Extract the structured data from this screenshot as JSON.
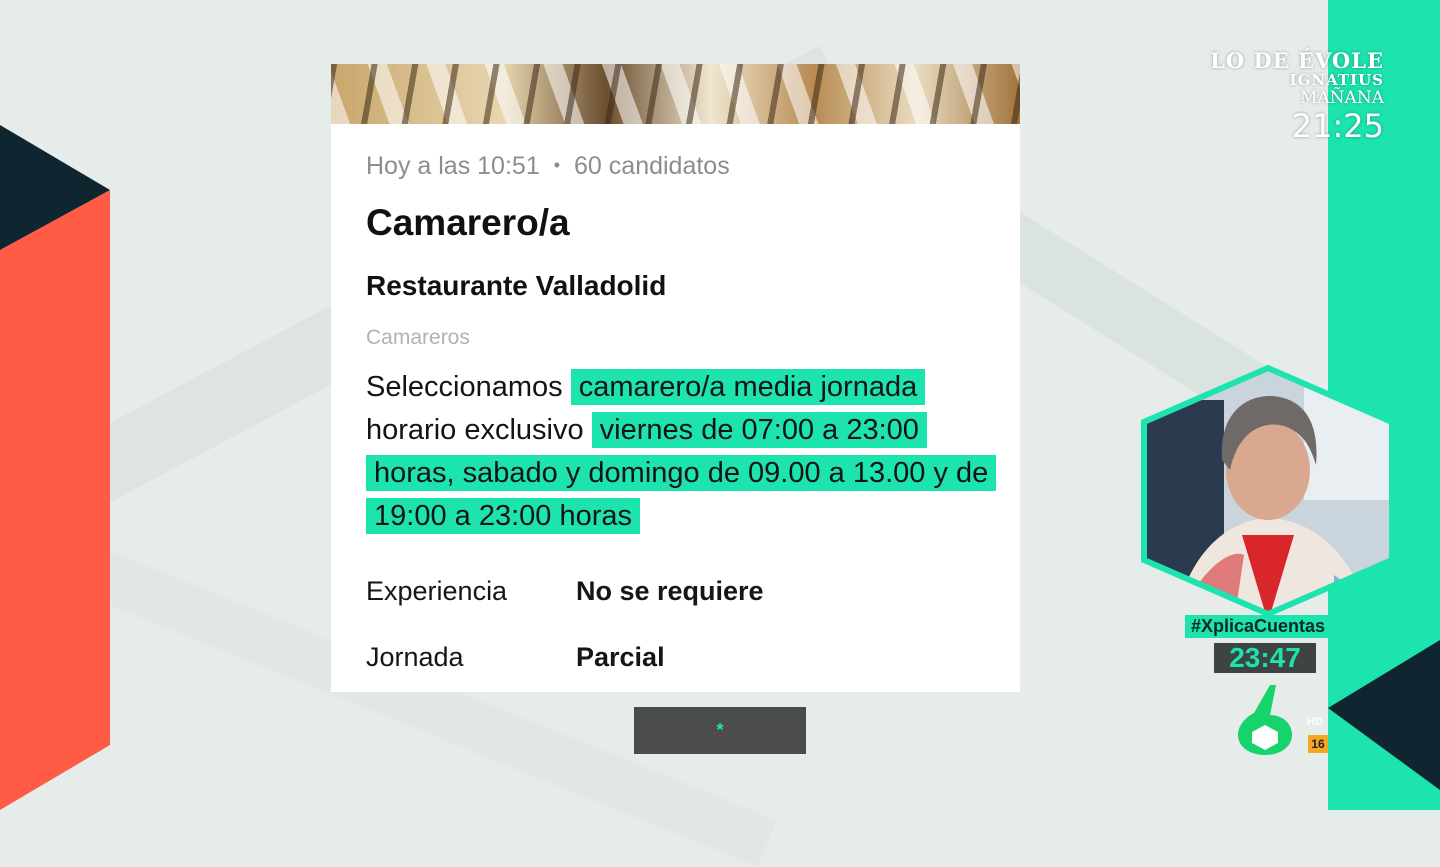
{
  "job_card": {
    "meta_time": "Hoy a las 10:51",
    "meta_separator": "•",
    "meta_candidates": "60 candidatos",
    "title": "Camarero/a",
    "company": "Restaurante Valladolid",
    "category": "Camareros",
    "description": {
      "part1": "Seleccionamos ",
      "highlight1": "camarero/a media jornada",
      "part2": " horario exclusivo ",
      "highlight2": "viernes de 07:00 a 23:00 horas, sabado y domingo de 09.00 a 13.00 y de 19:00 a 23:00 horas"
    },
    "details": [
      {
        "label": "Experiencia",
        "value": "No se requiere"
      },
      {
        "label": "Jornada",
        "value": "Parcial"
      }
    ]
  },
  "bottom_bar": {
    "label": "*"
  },
  "tv_overlay": {
    "promo_show": "LO DE ÉVOLE",
    "promo_guest": "IGNATIUS",
    "promo_day": "MAÑANA",
    "promo_time": "21:25",
    "hashtag": "#XplicaCuentas",
    "clock": "23:47",
    "channel_logo": "laSexta 6 logo",
    "hd_label": "HD",
    "age_rating": "16"
  },
  "colors": {
    "accent_teal": "#1de3ae",
    "coral": "#ff5b45",
    "dark_navy": "#0f2630",
    "card_bg": "#ffffff",
    "bar_grey": "#4b4d4c"
  }
}
